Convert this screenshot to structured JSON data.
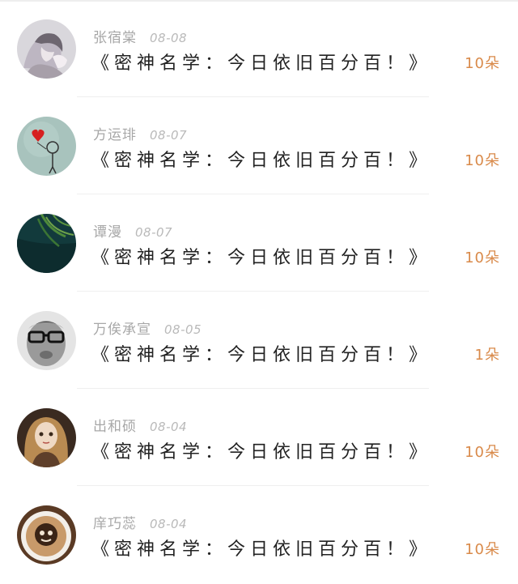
{
  "gift_list": {
    "items": [
      {
        "user": "张宿棠",
        "date": "08-08",
        "message": "《密神名学：今日依旧百分百！》",
        "count": "10朵",
        "avatar_icon": "anime-couple-avatar"
      },
      {
        "user": "方运琲",
        "date": "08-07",
        "message": "《密神名学：今日依旧百分百！》",
        "count": "10朵",
        "avatar_icon": "doodle-heart-balloon-avatar"
      },
      {
        "user": "谭漫",
        "date": "08-07",
        "message": "《密神名学：今日依旧百分百！》",
        "count": "10朵",
        "avatar_icon": "green-leaves-avatar"
      },
      {
        "user": "万俟承宣",
        "date": "08-05",
        "message": "《密神名学：今日依旧百分百！》",
        "count": "1朵",
        "avatar_icon": "glasses-kid-avatar"
      },
      {
        "user": "出和硕",
        "date": "08-04",
        "message": "《密神名学：今日依旧百分百！》",
        "count": "10朵",
        "avatar_icon": "doll-girl-avatar"
      },
      {
        "user": "庠巧蕊",
        "date": "08-04",
        "message": "《密神名学：今日依旧百分百！》",
        "count": "10朵",
        "avatar_icon": "latte-art-avatar"
      }
    ]
  },
  "colors": {
    "count_accent": "#d98a4a",
    "meta_text": "#a7a7a7",
    "title_text": "#222222"
  }
}
